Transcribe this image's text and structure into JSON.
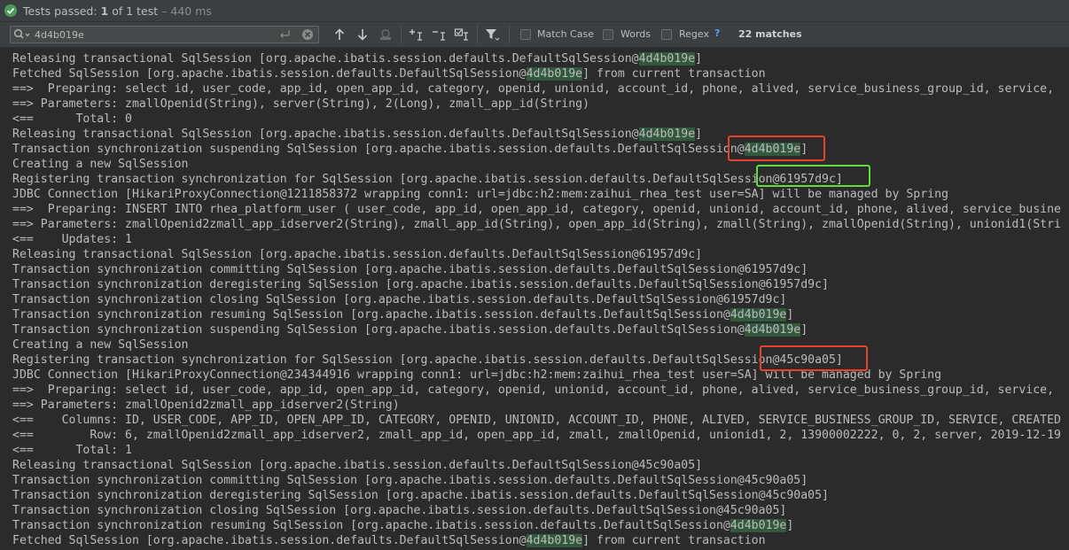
{
  "status": {
    "label": "Tests passed: ",
    "count": "1",
    "of_text": " of 1 test",
    "time": " – 440 ms"
  },
  "find": {
    "query": "4d4b019e",
    "match_case": "Match Case",
    "words": "Words",
    "regex": "Regex",
    "help": "?",
    "matches": "22 matches"
  },
  "colors": {
    "highlight": "#32593d",
    "red_frame": "#e8412c",
    "green_frame": "#5fdc3f"
  },
  "log": [
    [
      "Releasing transactional SqlSession [org.apache.ibatis.session.defaults.DefaultSqlSession@",
      "4d4b019e",
      "]"
    ],
    [
      "Fetched SqlSession [org.apache.ibatis.session.defaults.DefaultSqlSession@",
      "4d4b019e",
      "] from current transaction"
    ],
    [
      "==>  Preparing: select id, user_code, app_id, open_app_id, category, openid, unionid, account_id, phone, alived, service_business_group_id, service,"
    ],
    [
      "==> Parameters: zmallOpenid(String), server(String), 2(Long), zmall_app_id(String)"
    ],
    [
      "<==      Total: 0"
    ],
    [
      "Releasing transactional SqlSession [org.apache.ibatis.session.defaults.DefaultSqlSession@",
      "4d4b019e",
      "]"
    ],
    [
      "Transaction synchronization suspending SqlSession [org.apache.ibatis.session.defaults.DefaultSqlSession@",
      "4d4b019e",
      "]"
    ],
    [
      "Creating a new SqlSession"
    ],
    [
      "Registering transaction synchronization for SqlSession [org.apache.ibatis.session.defaults.DefaultSqlSession@61957d9c]"
    ],
    [
      "JDBC Connection [HikariProxyConnection@1211858372 wrapping conn1: url=jdbc:h2:mem:zaihui_rhea_test user=SA] will be managed by Spring"
    ],
    [
      "==>  Preparing: INSERT INTO rhea_platform_user ( user_code, app_id, open_app_id, category, openid, unionid, account_id, phone, alived, service_busine"
    ],
    [
      "==> Parameters: zmallOpenid2zmall_app_idserver2(String), zmall_app_id(String), open_app_id(String), zmall(String), zmallOpenid(String), unionid1(Stri"
    ],
    [
      "<==    Updates: 1"
    ],
    [
      "Releasing transactional SqlSession [org.apache.ibatis.session.defaults.DefaultSqlSession@61957d9c]"
    ],
    [
      "Transaction synchronization committing SqlSession [org.apache.ibatis.session.defaults.DefaultSqlSession@61957d9c]"
    ],
    [
      "Transaction synchronization deregistering SqlSession [org.apache.ibatis.session.defaults.DefaultSqlSession@61957d9c]"
    ],
    [
      "Transaction synchronization closing SqlSession [org.apache.ibatis.session.defaults.DefaultSqlSession@61957d9c]"
    ],
    [
      "Transaction synchronization resuming SqlSession [org.apache.ibatis.session.defaults.DefaultSqlSession@",
      "4d4b019e",
      "]"
    ],
    [
      "Transaction synchronization suspending SqlSession [org.apache.ibatis.session.defaults.DefaultSqlSession@",
      "4d4b019e",
      "]"
    ],
    [
      "Creating a new SqlSession"
    ],
    [
      "Registering transaction synchronization for SqlSession [org.apache.ibatis.session.defaults.DefaultSqlSession@45c90a05]"
    ],
    [
      "JDBC Connection [HikariProxyConnection@234344916 wrapping conn1: url=jdbc:h2:mem:zaihui_rhea_test user=SA] will be managed by Spring"
    ],
    [
      "==>  Preparing: select id, user_code, app_id, open_app_id, category, openid, unionid, account_id, phone, alived, service_business_group_id, service,"
    ],
    [
      "==> Parameters: zmallOpenid2zmall_app_idserver2(String)"
    ],
    [
      "<==    Columns: ID, USER_CODE, APP_ID, OPEN_APP_ID, CATEGORY, OPENID, UNIONID, ACCOUNT_ID, PHONE, ALIVED, SERVICE_BUSINESS_GROUP_ID, SERVICE, CREATED"
    ],
    [
      "<==        Row: 6, zmallOpenid2zmall_app_idserver2, zmall_app_id, open_app_id, zmall, zmallOpenid, unionid1, 2, 13900002222, 0, 2, server, 2019-12-19"
    ],
    [
      "<==      Total: 1"
    ],
    [
      "Releasing transactional SqlSession [org.apache.ibatis.session.defaults.DefaultSqlSession@45c90a05]"
    ],
    [
      "Transaction synchronization committing SqlSession [org.apache.ibatis.session.defaults.DefaultSqlSession@45c90a05]"
    ],
    [
      "Transaction synchronization deregistering SqlSession [org.apache.ibatis.session.defaults.DefaultSqlSession@45c90a05]"
    ],
    [
      "Transaction synchronization closing SqlSession [org.apache.ibatis.session.defaults.DefaultSqlSession@45c90a05]"
    ],
    [
      "Transaction synchronization resuming SqlSession [org.apache.ibatis.session.defaults.DefaultSqlSession@",
      "4d4b019e",
      "]"
    ],
    [
      "Fetched SqlSession [org.apache.ibatis.session.defaults.DefaultSqlSession@",
      "4d4b019e",
      "] from current transaction"
    ]
  ]
}
